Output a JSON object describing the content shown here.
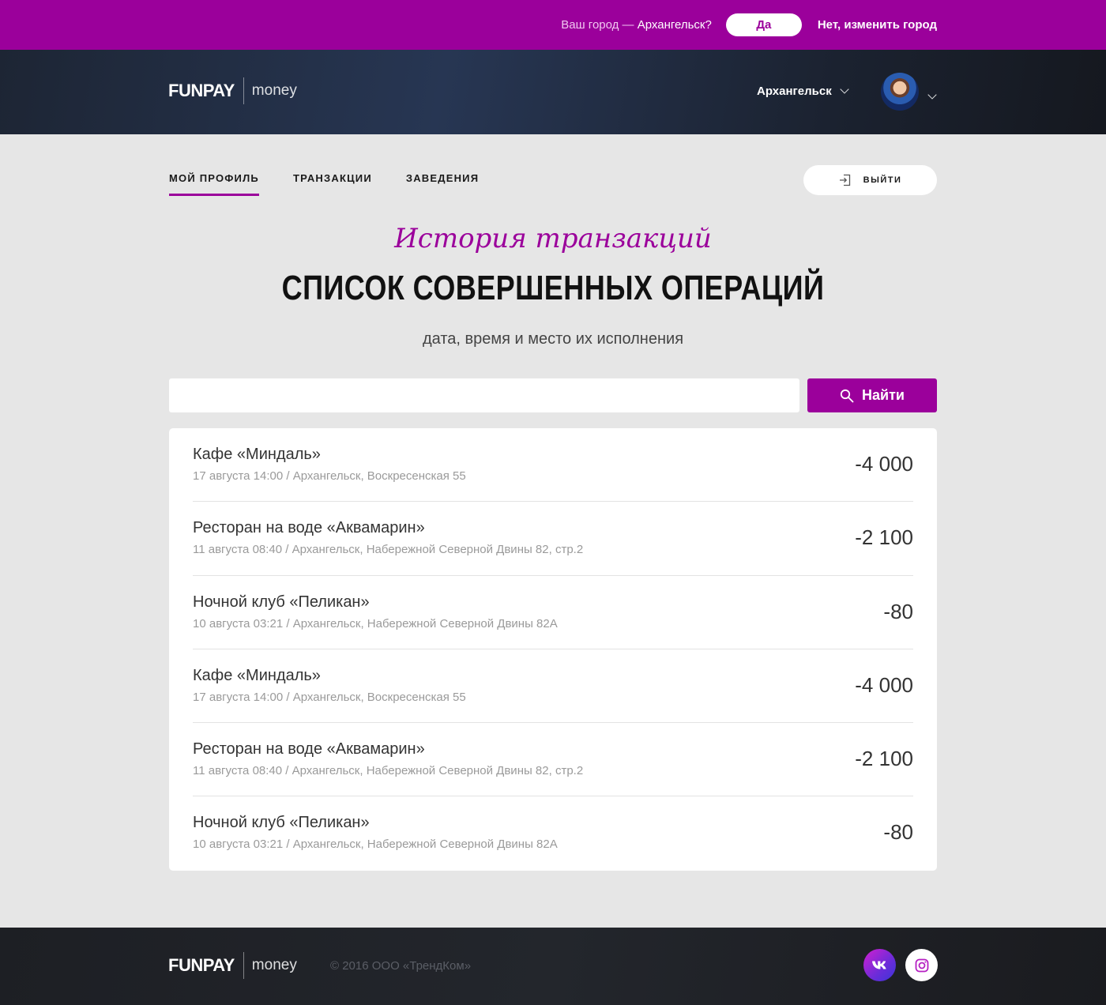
{
  "city_prompt": {
    "question_prefix": "Ваш город — ",
    "city": "Архангельск?",
    "yes_label": "Да",
    "change_label": "Нет, изменить город"
  },
  "header": {
    "logo_brand": "FUNPAY",
    "logo_sub": "money",
    "city": "Архангельск"
  },
  "nav": {
    "tabs": [
      {
        "label": "МОЙ ПРОФИЛЬ",
        "active": true
      },
      {
        "label": "ТРАНЗАКЦИИ",
        "active": false
      },
      {
        "label": "ЗАВЕДЕНИЯ",
        "active": false
      }
    ],
    "logout_label": "ВЫЙТИ"
  },
  "hero": {
    "script_title": "История транзакций",
    "title": "СПИСОК СОВЕРШЕННЫХ ОПЕРАЦИЙ",
    "subtitle": "дата, время и место их исполнения"
  },
  "search": {
    "value": "",
    "button_label": "Найти"
  },
  "transactions": [
    {
      "place": "Кафе «Миндаль»",
      "meta": "17 августа 14:00 / Архангельск, Воскресенская 55",
      "amount": "-4 000"
    },
    {
      "place": "Ресторан на воде «Аквамарин»",
      "meta": "11 августа 08:40 / Архангельск, Набережной Северной Двины 82, стр.2",
      "amount": "-2 100"
    },
    {
      "place": "Ночной клуб «Пеликан»",
      "meta": "10 августа 03:21 / Архангельск, Набережной Северной Двины 82А",
      "amount": "-80"
    },
    {
      "place": "Кафе «Миндаль»",
      "meta": "17 августа 14:00 / Архангельск, Воскресенская 55",
      "amount": "-4 000"
    },
    {
      "place": "Ресторан на воде «Аквамарин»",
      "meta": "11 августа 08:40 / Архангельск, Набережной Северной Двины 82, стр.2",
      "amount": "-2 100"
    },
    {
      "place": "Ночной клуб «Пеликан»",
      "meta": "10 августа 03:21 / Архангельск, Набережной Северной Двины 82А",
      "amount": "-80"
    }
  ],
  "footer": {
    "logo_brand": "FUNPAY",
    "logo_sub": "money",
    "copyright": "© 2016 ООО «ТрендКом»",
    "social": [
      "vk-icon",
      "instagram-icon"
    ]
  },
  "colors": {
    "accent": "#9b009b",
    "header_dark": "#1d2534",
    "background": "#e6e6e6"
  }
}
